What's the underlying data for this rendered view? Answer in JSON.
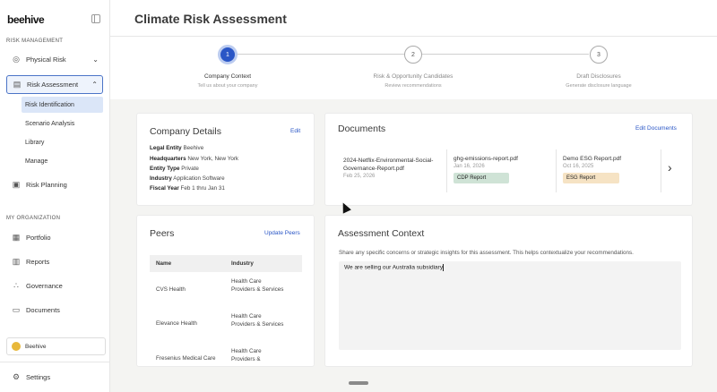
{
  "app": {
    "logo_text": "beehive"
  },
  "sidebar": {
    "sections": [
      {
        "label": "RISK MANAGEMENT"
      },
      {
        "label": "MY ORGANIZATION"
      }
    ],
    "items": [
      {
        "label": "Physical Risk",
        "icon": "globe-icon"
      },
      {
        "label": "Risk Assessment",
        "icon": "clipboard-icon"
      },
      {
        "label": "Risk Planning",
        "icon": "planning-icon"
      },
      {
        "label": "Portfolio",
        "icon": "building-icon"
      },
      {
        "label": "Reports",
        "icon": "report-icon"
      },
      {
        "label": "Governance",
        "icon": "governance-icon"
      },
      {
        "label": "Documents",
        "icon": "folder-icon"
      }
    ],
    "subitems": [
      {
        "label": "Risk Identification"
      },
      {
        "label": "Scenario Analysis"
      },
      {
        "label": "Library"
      },
      {
        "label": "Manage"
      }
    ],
    "org": {
      "name": "Beehive"
    },
    "settings_label": "Settings"
  },
  "header": {
    "title": "Climate Risk Assessment"
  },
  "stepper": {
    "steps": [
      {
        "number": "1",
        "title": "Company Context",
        "subtitle": "Tell us about your company"
      },
      {
        "number": "2",
        "title": "Risk & Opportunity Candidates",
        "subtitle": "Review recommendations"
      },
      {
        "number": "3",
        "title": "Draft Disclosures",
        "subtitle": "Generate disclosure language"
      }
    ]
  },
  "company": {
    "title": "Company Details",
    "edit_label": "Edit",
    "rows": [
      {
        "key": "Legal Entity",
        "value": "Beehive"
      },
      {
        "key": "Headquarters",
        "value": "New York, New York"
      },
      {
        "key": "Entity Type",
        "value": "Private"
      },
      {
        "key": "Industry",
        "value": "Application Software"
      },
      {
        "key": "Fiscal Year",
        "value": "Feb 1 thru Jan 31"
      }
    ]
  },
  "documents": {
    "title": "Documents",
    "edit_label": "Edit Documents",
    "files": [
      {
        "name": "2024-Netflix-Environmental-Social-Governance-Report.pdf",
        "date": "Feb 25, 2026",
        "tag": ""
      },
      {
        "name": "ghg-emissions-report.pdf",
        "date": "Jan 16, 2026",
        "tag": "CDP Report"
      },
      {
        "name": "Demo ESG Report.pdf",
        "date": "Oct 16, 2025",
        "tag": "ESG Report"
      }
    ],
    "colors": {
      "cdp_tag": "#cfe3d6",
      "esg_tag": "#f6e3c4"
    }
  },
  "peers": {
    "title": "Peers",
    "update_label": "Update Peers",
    "columns": [
      "Name",
      "Industry"
    ],
    "rows": [
      {
        "name": "CVS Health",
        "industry": "Health Care Providers & Services"
      },
      {
        "name": "Elevance Health",
        "industry": "Health Care Providers & Services"
      },
      {
        "name": "Fresenius Medical Care",
        "industry": "Health Care Providers &"
      }
    ]
  },
  "context": {
    "title": "Assessment Context",
    "description": "Share any specific concerns or strategic insights for this assessment. This helps contextualize your recommendations.",
    "value": "We are selling our Australia subsidiary"
  },
  "colors": {
    "accent": "#2a56c6",
    "active_bg": "#dbe6f8"
  }
}
